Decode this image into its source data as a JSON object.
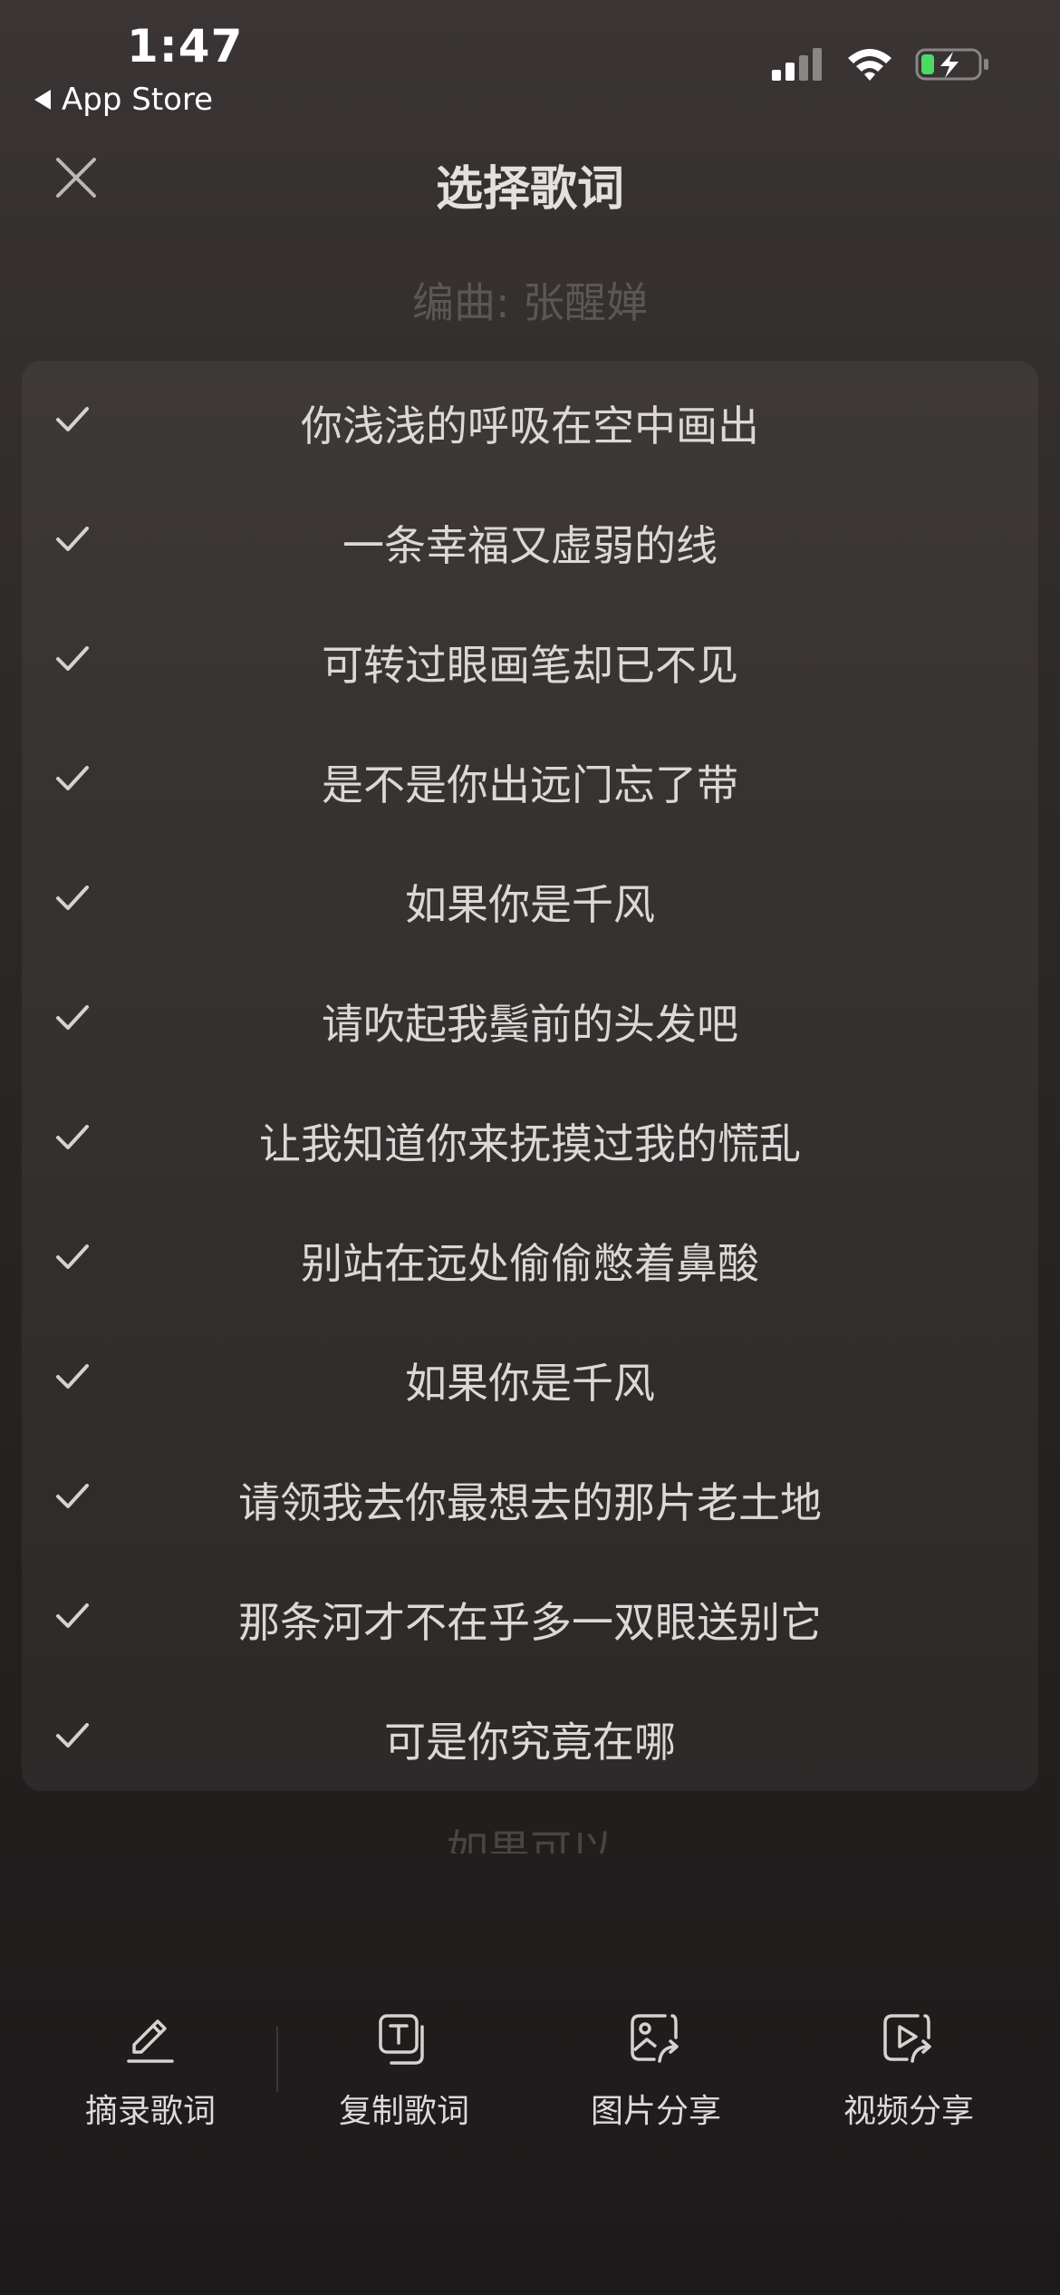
{
  "status": {
    "time": "1:47",
    "back_app": "App Store"
  },
  "header": {
    "title": "选择歌词"
  },
  "faded": {
    "above": "编曲: 张醒婵",
    "below": "如果可以"
  },
  "lyrics": [
    {
      "text": "你浅浅的呼吸在空中画出",
      "selected": true
    },
    {
      "text": "一条幸福又虚弱的线",
      "selected": true
    },
    {
      "text": "可转过眼画笔却已不见",
      "selected": true
    },
    {
      "text": "是不是你出远门忘了带",
      "selected": true
    },
    {
      "text": "如果你是千风",
      "selected": true
    },
    {
      "text": "请吹起我鬓前的头发吧",
      "selected": true
    },
    {
      "text": "让我知道你来抚摸过我的慌乱",
      "selected": true
    },
    {
      "text": "别站在远处偷偷憋着鼻酸",
      "selected": true
    },
    {
      "text": "如果你是千风",
      "selected": true
    },
    {
      "text": "请领我去你最想去的那片老土地",
      "selected": true
    },
    {
      "text": "那条河才不在乎多一双眼送别它",
      "selected": true
    },
    {
      "text": "可是你究竟在哪",
      "selected": true
    }
  ],
  "toolbar": {
    "excerpt": {
      "label": "摘录歌词",
      "icon": "pencil-icon"
    },
    "copy": {
      "label": "复制歌词",
      "icon": "copy-text-icon"
    },
    "image_share": {
      "label": "图片分享",
      "icon": "image-share-icon"
    },
    "video_share": {
      "label": "视频分享",
      "icon": "video-share-icon"
    }
  },
  "colors": {
    "battery_fill": "#4cd964",
    "text_primary": "#e9e6e6"
  }
}
